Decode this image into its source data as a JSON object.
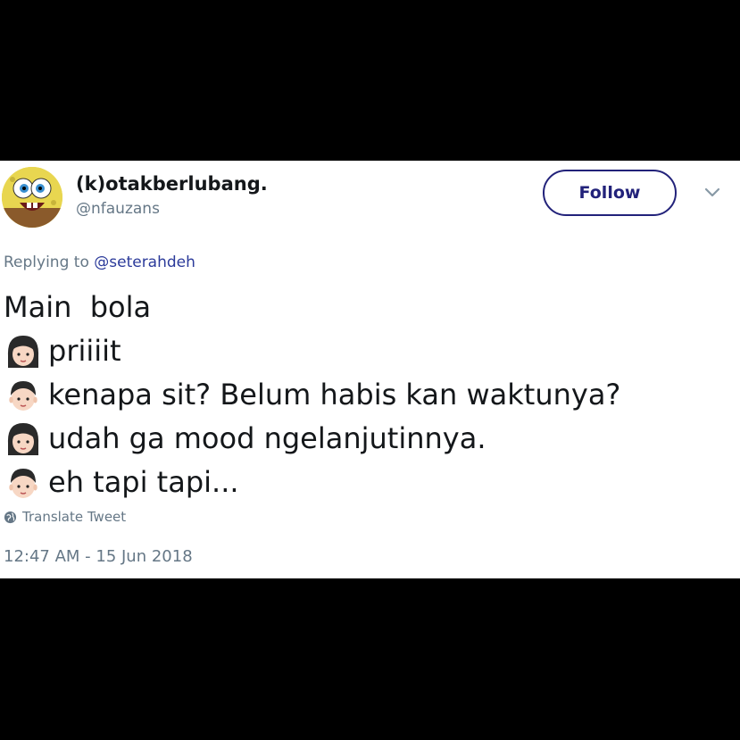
{
  "tweet": {
    "display_name": "(k)otakberlubang.",
    "handle": "@nfauzans",
    "follow_label": "Follow",
    "reply_prefix": "Replying to",
    "reply_handle": "@seterahdeh",
    "lines": [
      {
        "emoji": "",
        "text": "Main  bola"
      },
      {
        "emoji": "woman-face-icon",
        "text": "priiiit"
      },
      {
        "emoji": "man-face-icon",
        "text": "kenapa sit? Belum habis kan waktunya?"
      },
      {
        "emoji": "woman-face-icon",
        "text": "udah ga mood ngelanjutinnya."
      },
      {
        "emoji": "man-face-icon",
        "text": "eh tapi tapi..."
      }
    ],
    "translate_label": "Translate Tweet",
    "timestamp": "12:47 AM - 15 Jun 2018"
  },
  "colors": {
    "background": "#ffffff",
    "letterbox": "#000000",
    "follow_accent": "#22227a",
    "link": "#2b3a9a",
    "muted_text": "#657786"
  }
}
